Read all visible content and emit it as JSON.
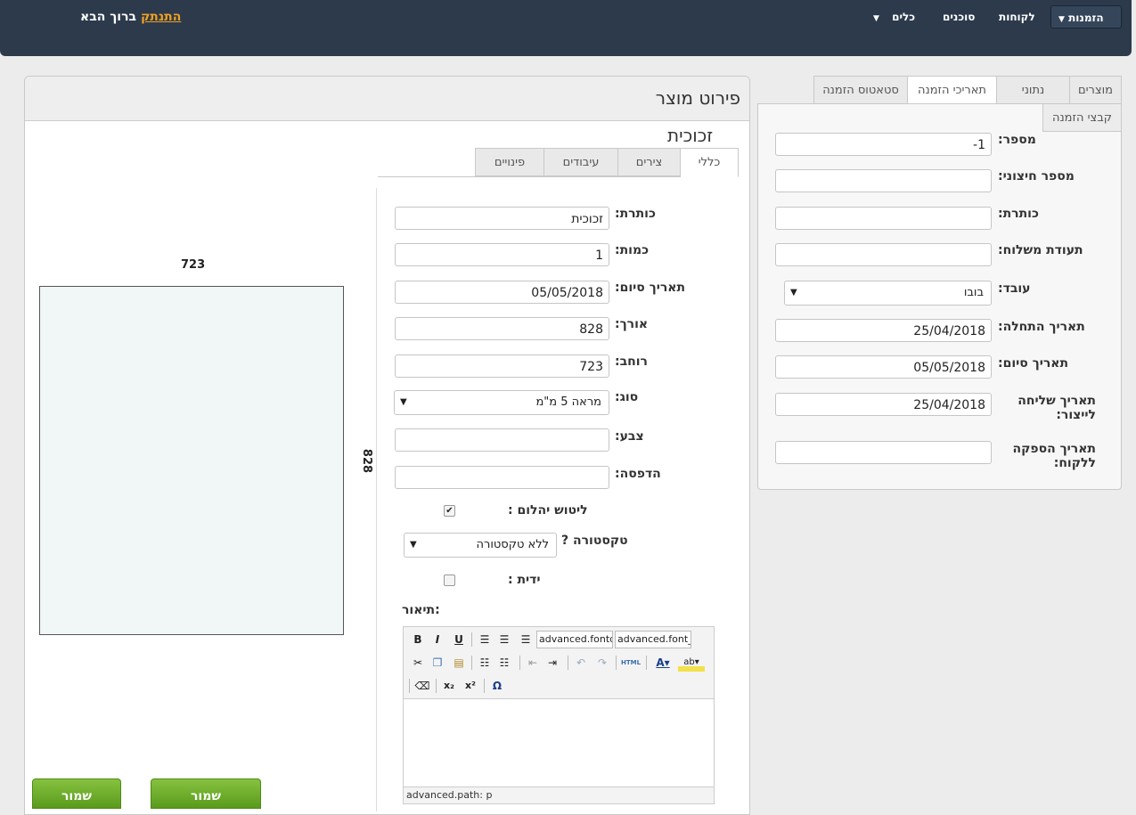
{
  "nav": {
    "orders": "הזמנות",
    "customers": "לקוחות",
    "agents": "סוכנים",
    "tools": "כלים",
    "welcome": "ברוך הבא",
    "logout": "התנתק"
  },
  "left": {
    "title": "פירוט מוצר",
    "product_name": "זכוכית",
    "tabs": [
      "כללי",
      "צירים",
      "עיבודים",
      "פינויים"
    ],
    "fields": {
      "title_label": "כותרת:",
      "title_value": "זכוכית",
      "qty_label": "כמות:",
      "qty_value": "1",
      "end_date_label": "תאריך סיום:",
      "end_date_value": "05/05/2018",
      "length_label": "אורך:",
      "length_value": "828",
      "width_label": "רוחב:",
      "width_value": "723",
      "type_label": "סוג:",
      "type_value": "מראה 5 מ\"מ",
      "color_label": "צבע:",
      "color_value": "",
      "print_label": "הדפסה:",
      "print_value": "",
      "polish_label": "ליטוש יהלום :",
      "polish_checked": true,
      "texture_label": "טקסטורה ?",
      "texture_value": "ללא טקסטורה",
      "handle_label": "ידית :",
      "handle_checked": false,
      "desc_label": ":תיאור"
    },
    "editor": {
      "font_select": "advanced.fontd",
      "size_select": "advanced.font_",
      "path": "advanced.path: p",
      "html_label": "HTML"
    },
    "preview": {
      "width": "723",
      "height": "828"
    },
    "save_buttons": [
      "שמור",
      "שמור"
    ]
  },
  "right": {
    "tabs": [
      "מוצרים",
      "נתוני",
      "תאריכי הזמנה",
      "סטאטוס הזמנה"
    ],
    "subtab": "קבצי הזמנה",
    "fields": {
      "number_label": "מספר:",
      "number_value": "-1",
      "external_label": "מספר חיצוני:",
      "external_value": "",
      "title_label": "כותרת:",
      "title_value": "",
      "shipping_label": "תעודת משלוח:",
      "shipping_value": "",
      "worker_label": "עובד:",
      "worker_value": "בובו",
      "start_label": "תאריך התחלה:",
      "start_value": "25/04/2018",
      "end_label": "תאריך סיום:",
      "end_value": "05/05/2018",
      "send_label": "תאריך שליחה לייצור:",
      "send_value": "25/04/2018",
      "supply_label": "תאריך הספקה ללקוח:",
      "supply_value": ""
    }
  }
}
